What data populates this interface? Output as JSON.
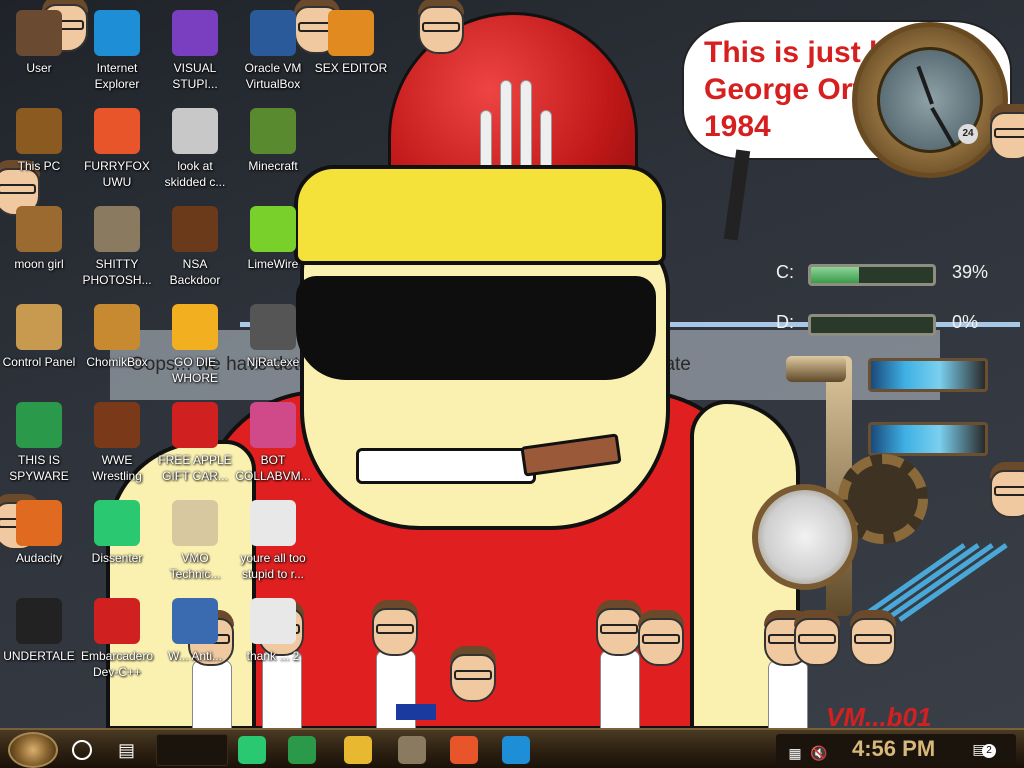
{
  "speech_bubble": {
    "text": "This is just like George Orwell's 1984"
  },
  "wallpaper_text": "Oops... we have detected that this has been deemed inappropriate",
  "clock": {
    "dial_badge": "24"
  },
  "drives": [
    {
      "label": "C:",
      "percent": "39%",
      "fill": 0.39
    },
    {
      "label": "D:",
      "percent": "0%",
      "fill": 0.0
    }
  ],
  "desktop_icons": [
    {
      "label": "User",
      "icon": "user-icon",
      "color": "#6a4a30"
    },
    {
      "label": "Internet Explorer",
      "icon": "edge-icon",
      "color": "#1e8fd6"
    },
    {
      "label": "VISUAL STUPI...",
      "icon": "visual-studio-icon",
      "color": "#7a3fc0"
    },
    {
      "label": "Oracle VM VirtualBox",
      "icon": "virtualbox-icon",
      "color": "#2a5a9a"
    },
    {
      "label": "SEX EDITOR",
      "icon": "hex-editor-icon",
      "color": "#e08a20"
    },
    {
      "label": "This PC",
      "icon": "computer-icon",
      "color": "#8a5a20"
    },
    {
      "label": "FURRYFOX UWU",
      "icon": "firefox-icon",
      "color": "#e8552a"
    },
    {
      "label": "look at skidded c...",
      "icon": "copy-icon",
      "color": "#c8c8c8"
    },
    {
      "label": "Minecraft",
      "icon": "minecraft-icon",
      "color": "#5a8a30"
    },
    {
      "label": "moon girl",
      "icon": "folder-icon",
      "color": "#9a6a30"
    },
    {
      "label": "SHITTY PHOTOSH...",
      "icon": "gimp-icon",
      "color": "#8a7a60"
    },
    {
      "label": "NSA Backdoor",
      "icon": "safe-icon",
      "color": "#6a3a1a"
    },
    {
      "label": "LimeWire",
      "icon": "limewire-icon",
      "color": "#7ad02a"
    },
    {
      "label": "Control Panel",
      "icon": "lightbulb-icon",
      "color": "#c89a50"
    },
    {
      "label": "ChomikBox",
      "icon": "hamster-icon",
      "color": "#c88a30"
    },
    {
      "label": "GO DIE WHORE",
      "icon": "dev-icon",
      "color": "#f2b020"
    },
    {
      "label": "NjRat.exe",
      "icon": "skull-icon",
      "color": "#555555"
    },
    {
      "label": "THIS IS SPYWARE",
      "icon": "chrome-icon",
      "color": "#2a9a4a"
    },
    {
      "label": "WWE Wrestling",
      "icon": "wwe-icon",
      "color": "#7a3a1a"
    },
    {
      "label": "FREE APPLE GIFT CAR...",
      "icon": "apple-icon",
      "color": "#d02020"
    },
    {
      "label": "BOT COLLABVM...",
      "icon": "monitor-icon",
      "color": "#d04a8a"
    },
    {
      "label": "Audacity",
      "icon": "audacity-icon",
      "color": "#e06a20"
    },
    {
      "label": "Dissenter",
      "icon": "dissenter-icon",
      "color": "#2ac870"
    },
    {
      "label": "VMO Technic...",
      "icon": "technician-icon",
      "color": "#d8c8a0"
    },
    {
      "label": "youre all too stupid to r...",
      "icon": "face-icon",
      "color": "#e8e8e8"
    },
    {
      "label": "UNDERTALE",
      "icon": "unity-icon",
      "color": "#222222"
    },
    {
      "label": "Embarcadero Dev-C++",
      "icon": "devcpp-icon",
      "color": "#d02020"
    },
    {
      "label": "W... Anti...",
      "icon": "shield-icon",
      "color": "#3a6ab0"
    },
    {
      "label": "thank ... 2",
      "icon": "document-icon",
      "color": "#e8e8e8"
    }
  ],
  "watermark": "VM...b01",
  "taskbar": {
    "time": "4:56 PM",
    "notification_count": "2",
    "apps": [
      {
        "icon": "dissenter-icon",
        "color": "#2ac870"
      },
      {
        "icon": "chrome-icon",
        "color": "#2a9a4a"
      },
      {
        "icon": "file-explorer-icon",
        "color": "#e8b830"
      },
      {
        "icon": "gimp-icon",
        "color": "#8a7a60"
      },
      {
        "icon": "firefox-icon",
        "color": "#e8552a"
      },
      {
        "icon": "edge-icon",
        "color": "#1e8fd6"
      }
    ]
  },
  "colors": {
    "bubble_text": "#d62020",
    "taskbar": "#2a1e10",
    "clock_text": "#d8b87a"
  }
}
